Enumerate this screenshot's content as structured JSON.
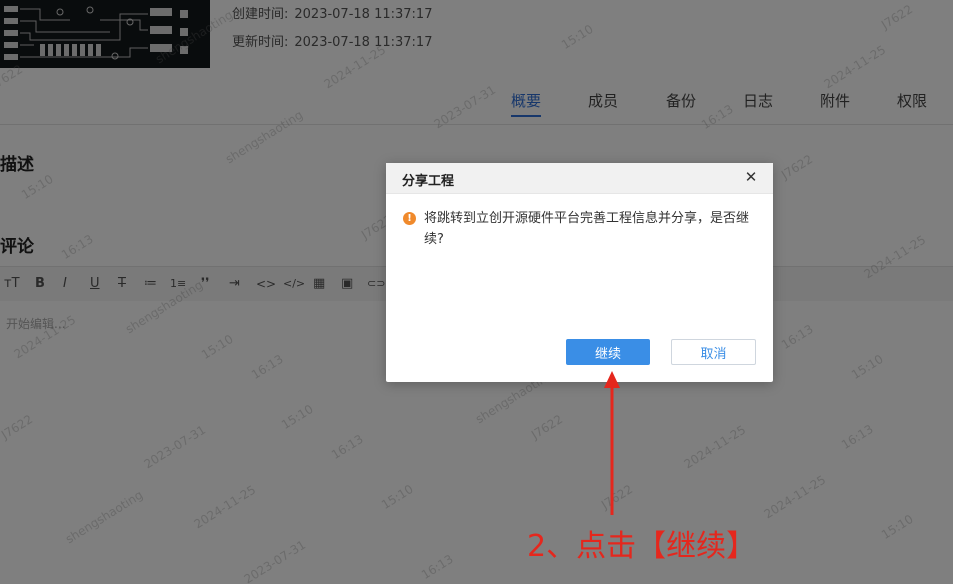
{
  "project": {
    "created": {
      "label": "创建时间:",
      "value": "2023-07-18 11:37:17"
    },
    "updated": {
      "label": "更新时间:",
      "value": "2023-07-18 11:37:17"
    }
  },
  "tabs": [
    {
      "label": "概要",
      "active": true
    },
    {
      "label": "成员",
      "active": false
    },
    {
      "label": "备份",
      "active": false
    },
    {
      "label": "日志",
      "active": false
    },
    {
      "label": "附件",
      "active": false
    },
    {
      "label": "权限",
      "active": false
    }
  ],
  "sections": {
    "description": "描述",
    "comments": "评论"
  },
  "editor": {
    "toolbar": [
      "тT",
      "B",
      "I",
      "U",
      "T",
      "≔",
      "1≡",
      "❜❜",
      "⇥",
      "<>",
      "</>",
      "▦",
      "▣",
      "⊂⊃"
    ],
    "placeholder": "开始编辑..."
  },
  "watermark": {
    "lines": [
      "J7622",
      "shengshaoting",
      "2024-11-25",
      "2023-07-31",
      "15:10",
      "16:13"
    ]
  },
  "dialog": {
    "title": "分享工程",
    "message": "将跳转到立创开源硬件平台完善工程信息并分享，是否继续?",
    "continue_label": "继续",
    "cancel_label": "取消",
    "warn_glyph": "!"
  },
  "annotation": {
    "text": "2、点击【继续】",
    "color": "#e5271d"
  },
  "colors": {
    "accent": "#3a8ee6",
    "tab_active": "#2f6fd6",
    "warning": "#f08a2c"
  }
}
